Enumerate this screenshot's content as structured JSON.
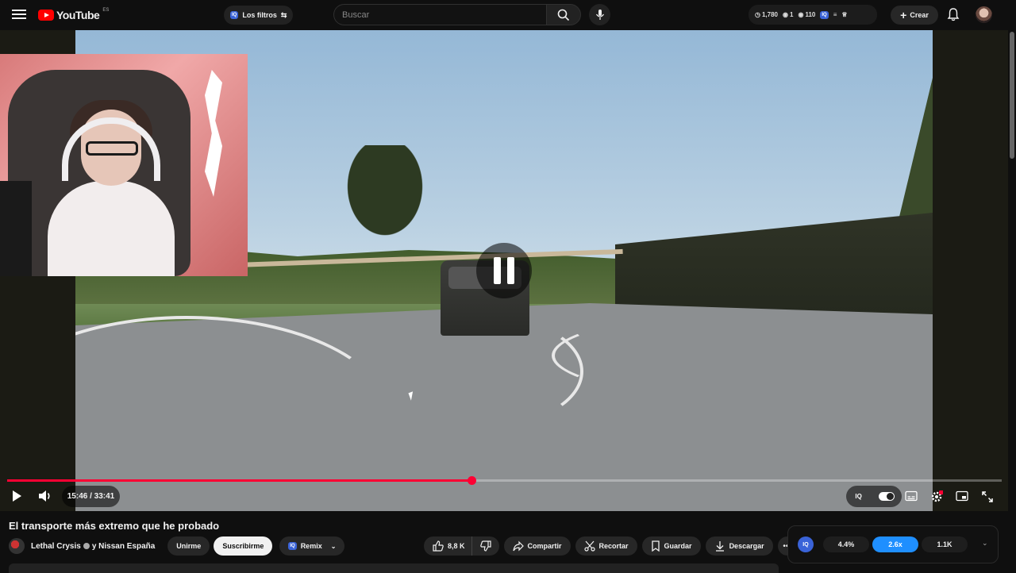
{
  "header": {
    "logo_text": "YouTube",
    "country_code": "ES",
    "filter_chip_label": "Los filtros",
    "search_placeholder": "Buscar",
    "stats": {
      "views": "1,780",
      "count1": "1",
      "count2": "110"
    },
    "create_label": "Crear"
  },
  "player": {
    "current_time": "15:46",
    "duration": "33:41",
    "time_display": "15:46 / 33:41",
    "progress_fraction": 0.467
  },
  "video": {
    "title": "El transporte más extremo que he probado",
    "channel": "Lethal Crysis",
    "collab": "y Nissan España",
    "join_label": "Unirme",
    "subscribe_label": "Suscribirme",
    "remix_label": "Remix",
    "likes": "8,8 K",
    "share_label": "Compartir",
    "clip_label": "Recortar",
    "save_label": "Guardar",
    "download_label": "Descargar"
  },
  "iq_panel": {
    "logo_text": "IQ",
    "stat1": "4.4%",
    "stat2": "2.6x",
    "stat3": "1.1K"
  },
  "colors": {
    "accent": "#ff0033",
    "iq_blue": "#1f8fff",
    "brand": "#ff0000"
  }
}
